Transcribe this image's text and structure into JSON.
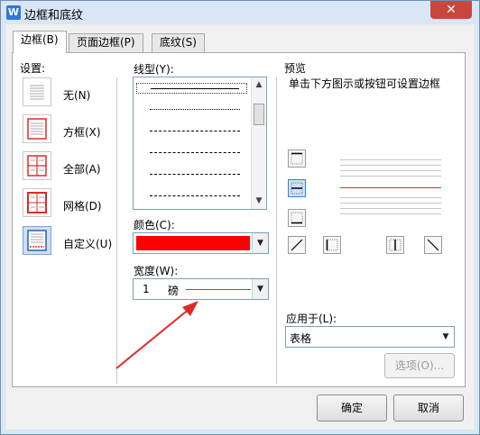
{
  "window": {
    "title": "边框和底纹",
    "app_icon": "W",
    "close_glyph": "✕"
  },
  "tabs": [
    {
      "label": "边框(B)",
      "active": true
    },
    {
      "label": "页面边框(P)",
      "active": false
    },
    {
      "label": "底纹(S)",
      "active": false
    }
  ],
  "settings": {
    "heading": "设置:",
    "items": [
      {
        "label": "无(N)",
        "icon": "none-border-icon"
      },
      {
        "label": "方框(X)",
        "icon": "box-border-icon"
      },
      {
        "label": "全部(A)",
        "icon": "all-border-icon"
      },
      {
        "label": "网格(D)",
        "icon": "grid-border-icon"
      },
      {
        "label": "自定义(U)",
        "icon": "custom-border-icon",
        "selected": true
      }
    ]
  },
  "line_style": {
    "label": "线型(Y):",
    "selected_index": 0
  },
  "color": {
    "label": "颜色(C):",
    "value": "#ff0000"
  },
  "width": {
    "label": "宽度(W):",
    "value": "1",
    "unit": "磅"
  },
  "preview": {
    "heading": "预览",
    "hint": "单击下方图示或按钮可设置边框",
    "line_color": "#d43030"
  },
  "apply_to": {
    "label": "应用于(L):",
    "value": "表格"
  },
  "buttons": {
    "options": "选项(O)...",
    "ok": "确定",
    "cancel": "取消"
  },
  "colors": {
    "title_bar": "#d9e6f5",
    "selection": "#ccdff5",
    "accent_red": "#e02a2a"
  }
}
